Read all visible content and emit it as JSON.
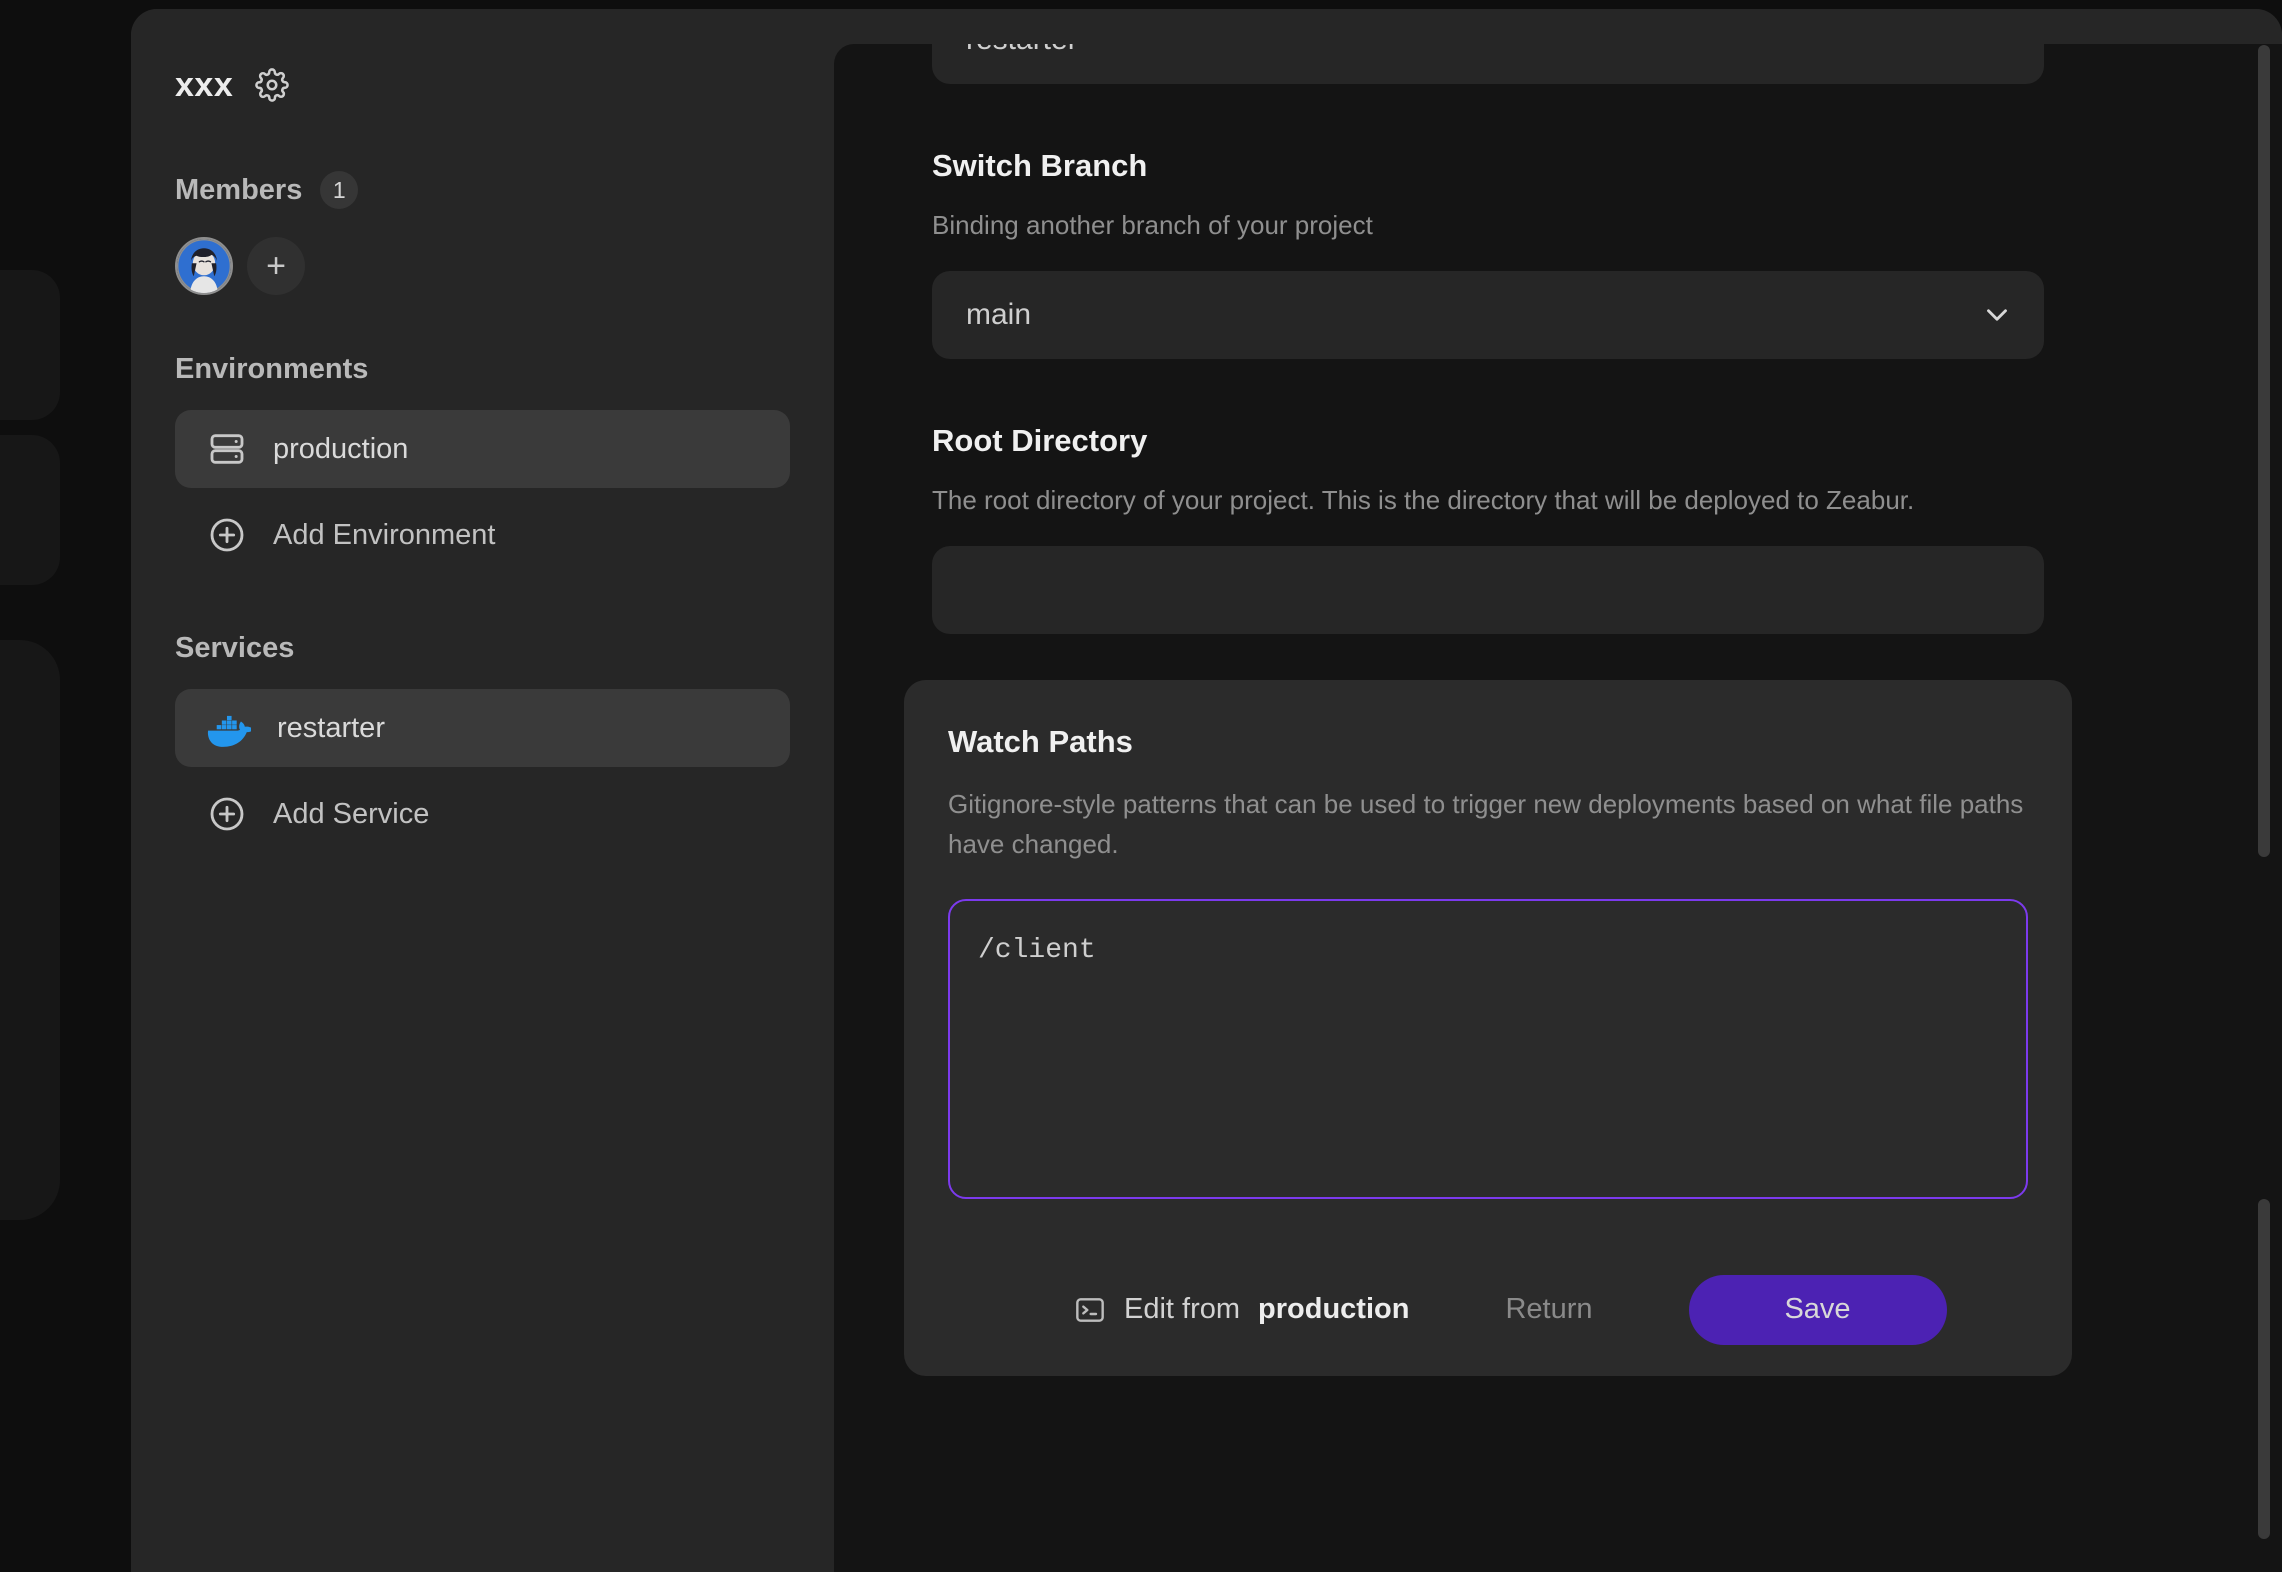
{
  "backdrop": {
    "label": "dimmed-page-behind-modal"
  },
  "sidebar": {
    "brand": {
      "title": "xxx",
      "settings_icon": "gear-icon"
    },
    "members": {
      "label": "Members",
      "count": "1",
      "add_label": "+"
    },
    "environments": {
      "label": "Environments",
      "items": [
        {
          "label": "production",
          "icon": "server-icon",
          "active": true
        }
      ],
      "add_label": "Add Environment",
      "add_icon": "plus-circle-icon"
    },
    "services": {
      "label": "Services",
      "items": [
        {
          "label": "restarter",
          "icon": "docker-icon",
          "active": true
        }
      ],
      "add_label": "Add Service",
      "add_icon": "plus-circle-icon"
    }
  },
  "main": {
    "service_name_field": {
      "value": "restarter"
    },
    "switch_branch": {
      "title": "Switch Branch",
      "description": "Binding another branch of your project",
      "selected": "main",
      "chevron_icon": "chevron-down-icon"
    },
    "root_directory": {
      "title": "Root Directory",
      "description": "The root directory of your project. This is the directory that will be deployed to Zeabur.",
      "value": ""
    },
    "watch_paths": {
      "title": "Watch Paths",
      "description": "Gitignore-style patterns that can be used to trigger new deployments based on what file paths have changed.",
      "value": "/client",
      "footer": {
        "edit_from_prefix": "Edit from",
        "edit_from_target": "production",
        "terminal_icon": "terminal-icon",
        "return_label": "Return",
        "save_label": "Save"
      }
    }
  },
  "colors": {
    "accent": "#7c3aed",
    "save_button": "#4c22b3",
    "panel": "#262626",
    "content": "#141414",
    "card": "#2b2b2b",
    "docker_blue": "#2396ed"
  }
}
